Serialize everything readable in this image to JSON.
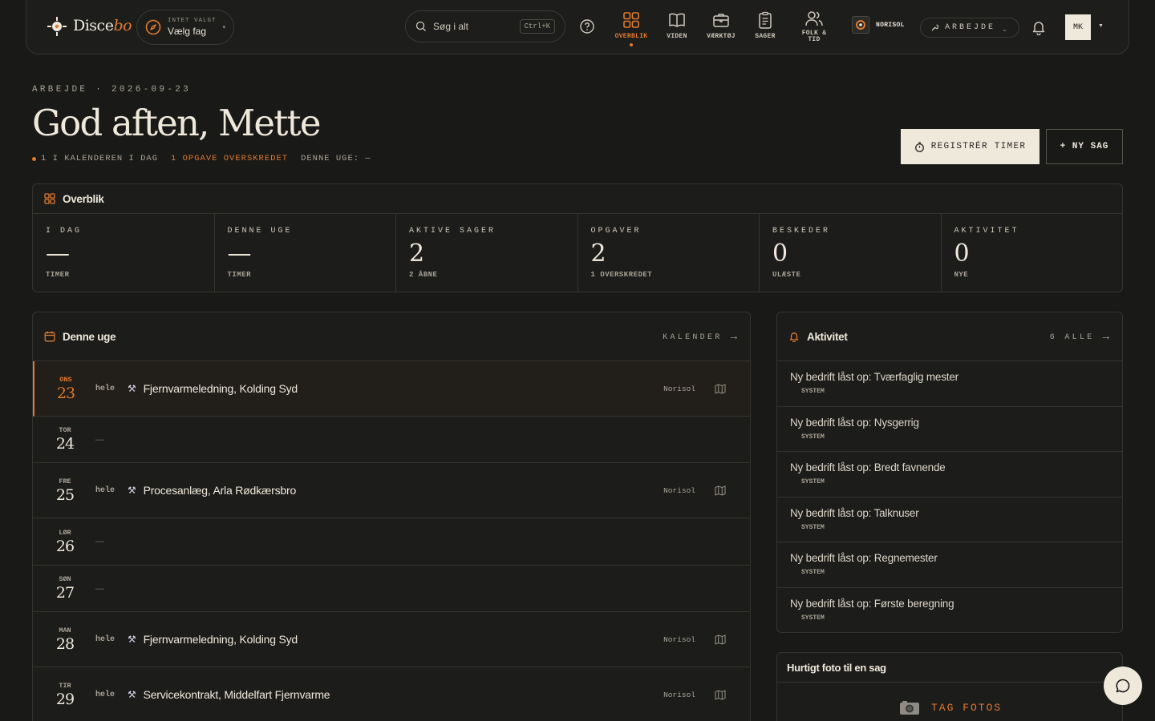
{
  "header": {
    "logo_text": "Disce",
    "logo_suffix": "bo",
    "trade_small": "INTET VALGT",
    "trade_main": "Vælg fag",
    "search_placeholder": "Søg i alt",
    "search_shortcut": "Ctrl+K",
    "nav": [
      {
        "label": "OVERBLIK",
        "icon": "grid-icon",
        "active": true
      },
      {
        "label": "VIDEN",
        "icon": "book-icon",
        "active": false
      },
      {
        "label": "VÆRKTØJ",
        "icon": "briefcase-icon",
        "active": false
      },
      {
        "label": "SAGER",
        "icon": "clipboard-icon",
        "active": false
      },
      {
        "label": "FOLK &",
        "label2": "TID",
        "icon": "users-icon",
        "active": false
      }
    ],
    "company": "NORISOL",
    "mode": "ARBEJDE",
    "avatar": "MK"
  },
  "hero": {
    "crumb": "ARBEJDE · 2026-09-23",
    "greeting": "God aften, Mette",
    "stat_calendar": "1 I KALENDEREN I DAG",
    "stat_overdue": "1 OPGAVE OVERSKREDET",
    "stat_week": "DENNE UGE: —",
    "btn_register": "REGISTRÉR TIMER",
    "btn_new": "+ NY SAG"
  },
  "overview": {
    "title": "Overblik",
    "cells": [
      {
        "label": "I DAG",
        "value": "—",
        "sub": "TIMER"
      },
      {
        "label": "DENNE UGE",
        "value": "—",
        "sub": "TIMER"
      },
      {
        "label": "AKTIVE SAGER",
        "value": "2",
        "sub": "2 ÅBNE"
      },
      {
        "label": "OPGAVER",
        "value": "2",
        "sub": "1 OVERSKREDET"
      },
      {
        "label": "BESKEDER",
        "value": "0",
        "sub": "ULÆSTE"
      },
      {
        "label": "AKTIVITET",
        "value": "0",
        "sub": "NYE"
      }
    ]
  },
  "week": {
    "title": "Denne uge",
    "link": "KALENDER",
    "days": [
      {
        "day": "ONS",
        "num": "23",
        "duration": "hele",
        "event": "Fjernvarmeledning, Kolding Syd",
        "company": "Norisol",
        "today": true
      },
      {
        "day": "TOR",
        "num": "24",
        "empty": "—"
      },
      {
        "day": "FRE",
        "num": "25",
        "duration": "hele",
        "event": "Procesanlæg, Arla Rødkærsbro",
        "company": "Norisol"
      },
      {
        "day": "LØR",
        "num": "26",
        "empty": "—"
      },
      {
        "day": "SØN",
        "num": "27",
        "empty": "—"
      },
      {
        "day": "MAN",
        "num": "28",
        "duration": "hele",
        "event": "Fjernvarmeledning, Kolding Syd",
        "company": "Norisol"
      },
      {
        "day": "TIR",
        "num": "29",
        "duration": "hele",
        "event": "Servicekontrakt, Middelfart Fjernvarme",
        "company": "Norisol"
      }
    ]
  },
  "activity": {
    "title": "Aktivitet",
    "link": "6 ALLE",
    "items": [
      {
        "text": "Ny bedrift låst op: Tværfaglig mester",
        "source": "SYSTEM"
      },
      {
        "text": "Ny bedrift låst op: Nysgerrig",
        "source": "SYSTEM"
      },
      {
        "text": "Ny bedrift låst op: Bredt favnende",
        "source": "SYSTEM"
      },
      {
        "text": "Ny bedrift låst op: Talknuser",
        "source": "SYSTEM"
      },
      {
        "text": "Ny bedrift låst op: Regnemester",
        "source": "SYSTEM"
      },
      {
        "text": "Ny bedrift låst op: Første beregning",
        "source": "SYSTEM"
      }
    ]
  },
  "photo": {
    "title": "Hurtigt foto til en sag",
    "button": "TAG FOTOS"
  },
  "colors": {
    "accent": "#e07a2e",
    "background": "#191917",
    "card": "#1c1c1a",
    "border": "#34342f",
    "cream": "#efe9dc"
  }
}
